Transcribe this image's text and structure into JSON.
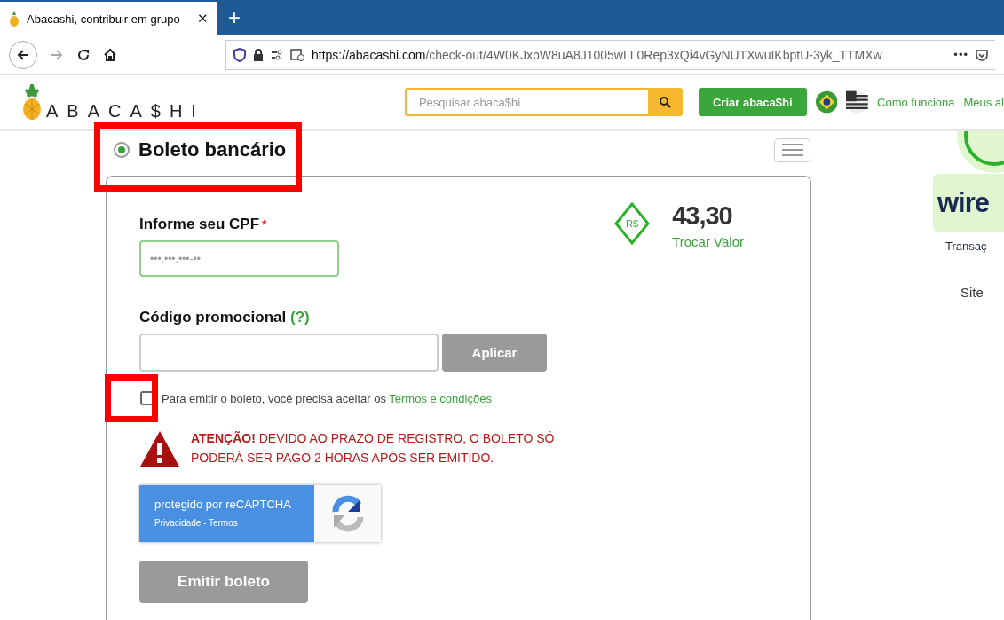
{
  "browser": {
    "tab": {
      "title": "Abacashi, contribuir em grupo",
      "close": "✕"
    },
    "new_tab": "+",
    "url": {
      "host": "https://abacashi.com",
      "path": "/check-out/4W0KJxpW8uA8J1005wLL0Rep3xQi4vGyNUTXwuIKbptU-3yk_TTMXw"
    },
    "menu": "•••"
  },
  "header": {
    "logo": "ABACA$HI",
    "search": {
      "placeholder": "Pesquisar abaca$hi"
    },
    "create_button": "Criar abaca$hi",
    "nav": [
      "Como funciona",
      "Meus al"
    ]
  },
  "payment": {
    "method": {
      "label": "Boleto bancário",
      "selected": true
    },
    "cpf": {
      "label": "Informe seu CPF",
      "required": "*",
      "placeholder": "•••.•••.•••-••"
    },
    "amount": {
      "currency": "R$",
      "value": "43,30",
      "link": "Trocar Valor"
    },
    "promo": {
      "label": "Código promocional",
      "help": "(?)",
      "button": "Aplicar"
    },
    "terms": {
      "checked": false,
      "text": "Para emitir o boleto, você precisa aceitar os",
      "link": "Termos e condições"
    },
    "warning": {
      "text": "**ATENÇÃO!** DEVIDO AO PRAZO DE REGISTRO, O BOLETO SÓ PODERÁ SER PAGO 2 HORAS APÓS SER EMITIDO."
    },
    "recaptcha": {
      "title": "protegido por reCAPTCHA",
      "links": "Privacidade - Termos"
    },
    "submit": "Emitir boleto"
  },
  "sidebar": {
    "logo": "wire",
    "caption": "Transaç",
    "text": "Site"
  },
  "annotations": [
    {
      "kind": "frame"
    },
    {
      "kind": "frame"
    }
  ]
}
